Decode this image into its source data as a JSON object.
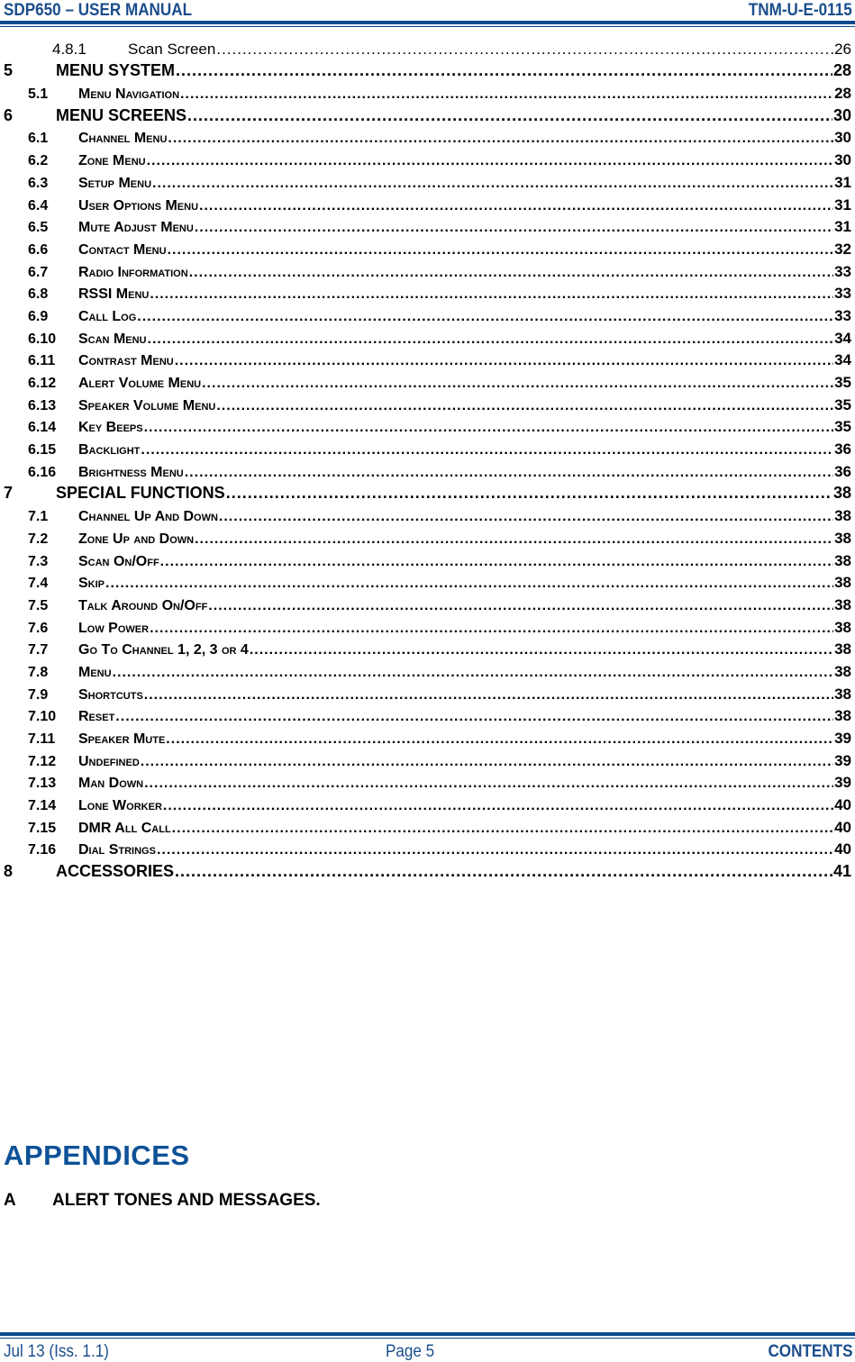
{
  "header": {
    "left": "SDP650 – USER MANUAL",
    "right": "TNM-U-E-0115"
  },
  "footer": {
    "left": "Jul 13 (Iss. 1.1)",
    "center": "Page 5",
    "right": "CONTENTS"
  },
  "colors": {
    "brand_blue": "#0a4a8c"
  },
  "toc": [
    {
      "level": 3,
      "num": "4.8.1",
      "title": "Scan Screen",
      "page": "26"
    },
    {
      "level": 1,
      "num": "5",
      "title": "MENU SYSTEM",
      "page": "28"
    },
    {
      "level": 2,
      "num": "5.1",
      "title": "Menu Navigation",
      "page": "28"
    },
    {
      "level": 1,
      "num": "6",
      "title": "MENU SCREENS",
      "page": "30"
    },
    {
      "level": 2,
      "num": "6.1",
      "title": "Channel Menu",
      "page": "30"
    },
    {
      "level": 2,
      "num": "6.2",
      "title": "Zone Menu",
      "page": "30"
    },
    {
      "level": 2,
      "num": "6.3",
      "title": "Setup Menu",
      "page": "31"
    },
    {
      "level": 2,
      "num": "6.4",
      "title": "User Options Menu",
      "page": "31"
    },
    {
      "level": 2,
      "num": "6.5",
      "title": "Mute Adjust Menu",
      "page": "31"
    },
    {
      "level": 2,
      "num": "6.6",
      "title": "Contact Menu",
      "page": "32"
    },
    {
      "level": 2,
      "num": "6.7",
      "title": "Radio Information",
      "page": "33"
    },
    {
      "level": 2,
      "num": "6.8",
      "title": "RSSI Menu",
      "page": "33"
    },
    {
      "level": 2,
      "num": "6.9",
      "title": "Call Log",
      "page": "33"
    },
    {
      "level": 2,
      "num": "6.10",
      "title": "Scan Menu",
      "page": "34"
    },
    {
      "level": 2,
      "num": "6.11",
      "title": "Contrast Menu",
      "page": "34"
    },
    {
      "level": 2,
      "num": "6.12",
      "title": "Alert Volume Menu",
      "page": "35"
    },
    {
      "level": 2,
      "num": "6.13",
      "title": "Speaker Volume Menu",
      "page": "35"
    },
    {
      "level": 2,
      "num": "6.14",
      "title": "Key Beeps",
      "page": "35"
    },
    {
      "level": 2,
      "num": "6.15",
      "title": "Backlight",
      "page": "36"
    },
    {
      "level": 2,
      "num": "6.16",
      "title": "Brightness Menu",
      "page": "36"
    },
    {
      "level": 1,
      "num": "7",
      "title": "SPECIAL FUNCTIONS",
      "page": "38"
    },
    {
      "level": 2,
      "num": "7.1",
      "title": "Channel Up And Down",
      "page": "38"
    },
    {
      "level": 2,
      "num": "7.2",
      "title": "Zone Up and Down",
      "page": "38"
    },
    {
      "level": 2,
      "num": "7.3",
      "title": "Scan On/Off",
      "page": "38"
    },
    {
      "level": 2,
      "num": "7.4",
      "title": "Skip",
      "page": "38"
    },
    {
      "level": 2,
      "num": "7.5",
      "title": "Talk Around On/Off",
      "page": "38"
    },
    {
      "level": 2,
      "num": "7.6",
      "title": "Low Power",
      "page": "38"
    },
    {
      "level": 2,
      "num": "7.7",
      "title": "Go To Channel 1, 2, 3 or 4",
      "page": "38"
    },
    {
      "level": 2,
      "num": "7.8",
      "title": "Menu",
      "page": "38"
    },
    {
      "level": 2,
      "num": "7.9",
      "title": "Shortcuts",
      "page": "38"
    },
    {
      "level": 2,
      "num": "7.10",
      "title": "Reset",
      "page": "38"
    },
    {
      "level": 2,
      "num": "7.11",
      "title": "Speaker Mute",
      "page": "39"
    },
    {
      "level": 2,
      "num": "7.12",
      "title": "Undefined",
      "page": "39"
    },
    {
      "level": 2,
      "num": "7.13",
      "title": "Man Down",
      "page": "39"
    },
    {
      "level": 2,
      "num": "7.14",
      "title": "Lone Worker",
      "page": "40"
    },
    {
      "level": 2,
      "num": "7.15",
      "title": "DMR All Call",
      "page": "40"
    },
    {
      "level": 2,
      "num": "7.16",
      "title": "Dial Strings",
      "page": "40"
    },
    {
      "level": 1,
      "num": "8",
      "title": "ACCESSORIES",
      "page": "41"
    }
  ],
  "appendices": {
    "heading": "APPENDICES",
    "items": [
      {
        "num": "A",
        "title": "ALERT TONES AND MESSAGES."
      }
    ]
  }
}
